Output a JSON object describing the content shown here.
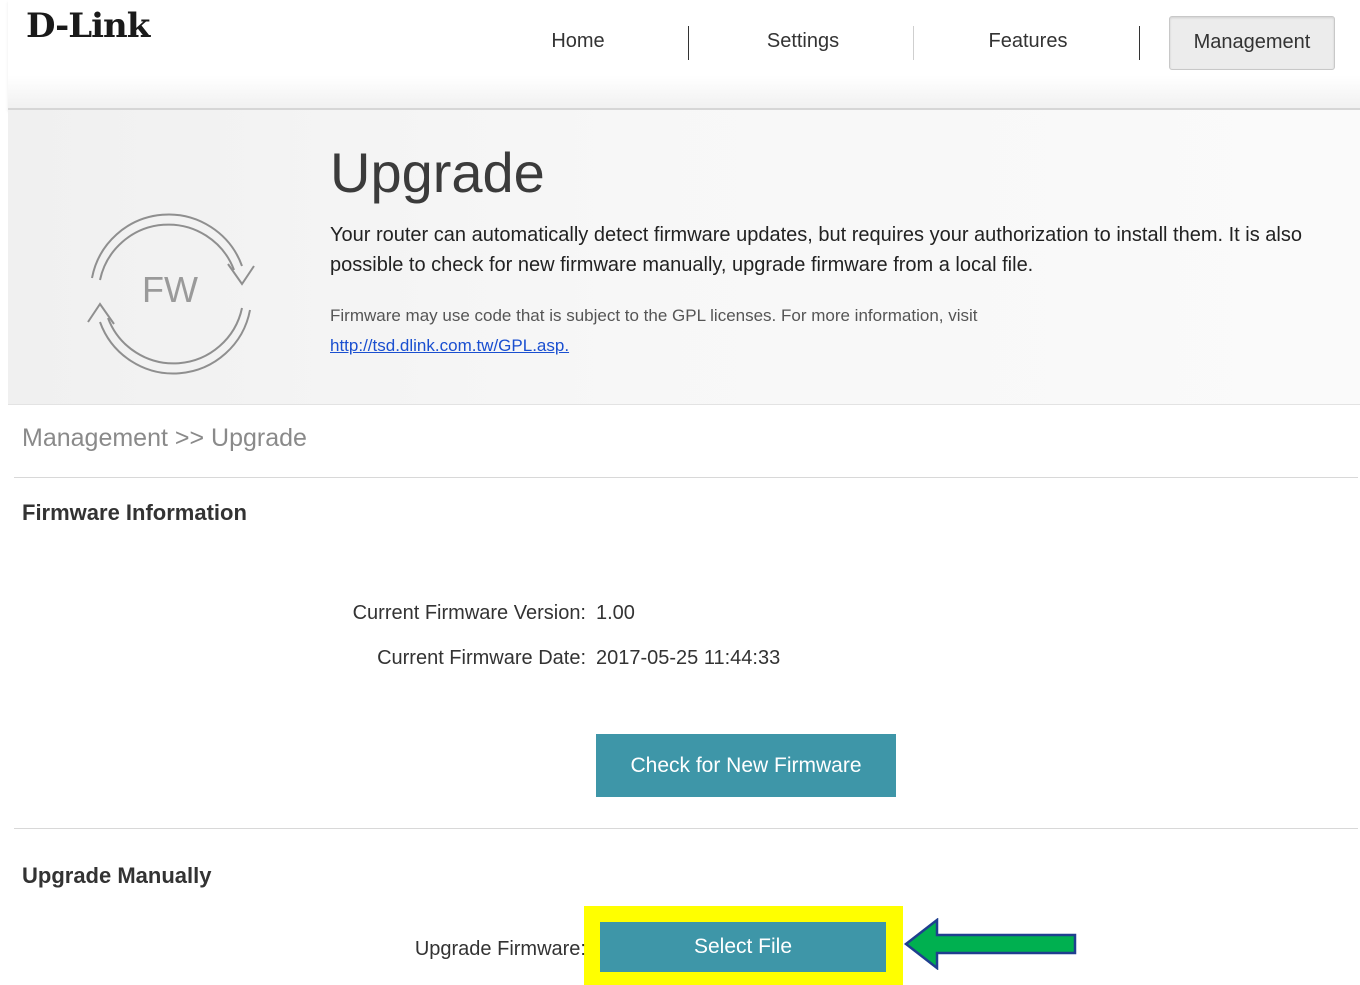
{
  "header": {
    "logo_text": "D-Link",
    "nav": [
      {
        "label": "Home",
        "active": false
      },
      {
        "label": "Settings",
        "active": false
      },
      {
        "label": "Features",
        "active": false
      },
      {
        "label": "Management",
        "active": true
      }
    ]
  },
  "banner": {
    "icon_label": "FW",
    "title": "Upgrade",
    "description": "Your router can automatically detect firmware updates, but requires your authorization to install them. It is also possible to check for new firmware manually, upgrade firmware from a local file.",
    "gpl_note": "Firmware may use code that is subject to the GPL licenses. For more information, visit",
    "gpl_link": "http://tsd.dlink.com.tw/GPL.asp."
  },
  "breadcrumb": "Management >> Upgrade",
  "firmware_info": {
    "section_title": "Firmware Information",
    "version_label": "Current Firmware Version:",
    "version_value": "1.00",
    "date_label": "Current Firmware Date:",
    "date_value": "2017-05-25 11:44:33",
    "check_button": "Check for New Firmware"
  },
  "manual": {
    "section_title": "Upgrade Manually",
    "upgrade_label": "Upgrade Firmware:",
    "select_button": "Select File"
  },
  "colors": {
    "button": "#3e96a8",
    "highlight": "#ffff00",
    "arrow": "#00b050",
    "arrow_outline": "#1f3f8f"
  }
}
